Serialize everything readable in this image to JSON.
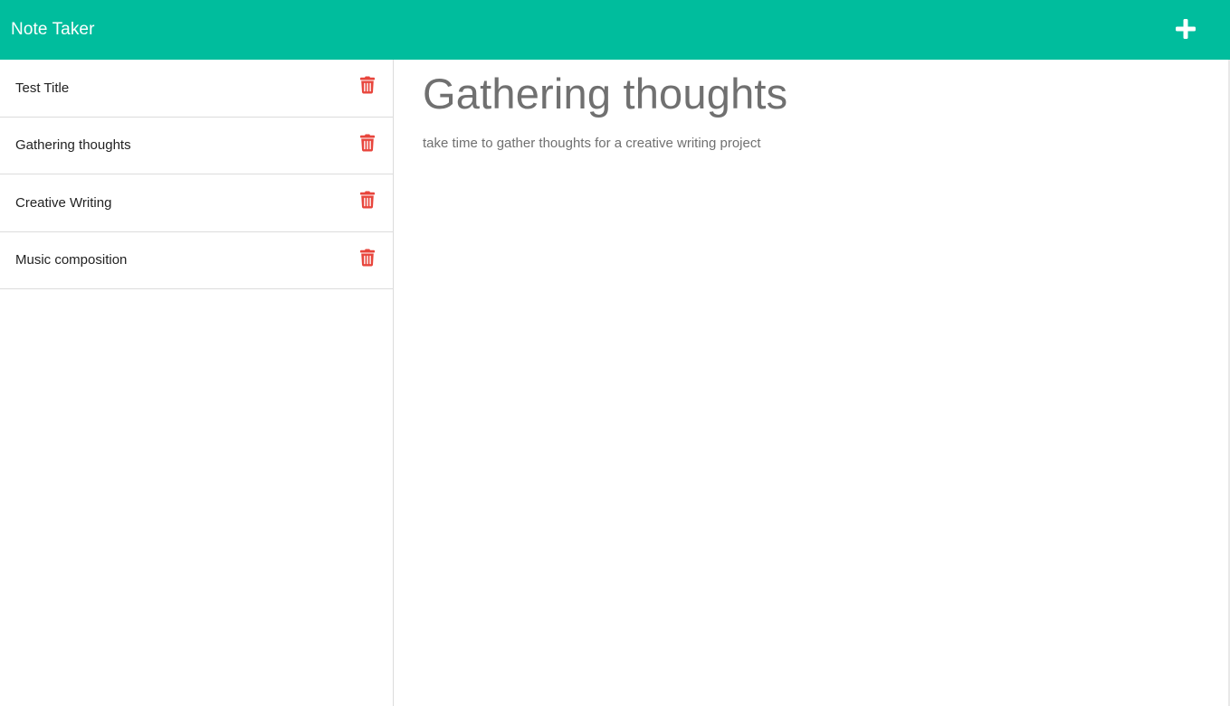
{
  "app": {
    "title": "Note Taker",
    "accent_color": "#00bd9d",
    "delete_color": "#e8453c"
  },
  "toolbar": {
    "new_note_icon": "plus-icon"
  },
  "sidebar": {
    "delete_icon": "trash-icon",
    "notes": [
      {
        "title": "Test Title"
      },
      {
        "title": "Gathering thoughts"
      },
      {
        "title": "Creative Writing"
      },
      {
        "title": "Music composition"
      }
    ]
  },
  "main": {
    "title": "Gathering thoughts",
    "body": "take time to gather thoughts for a creative writing project"
  }
}
